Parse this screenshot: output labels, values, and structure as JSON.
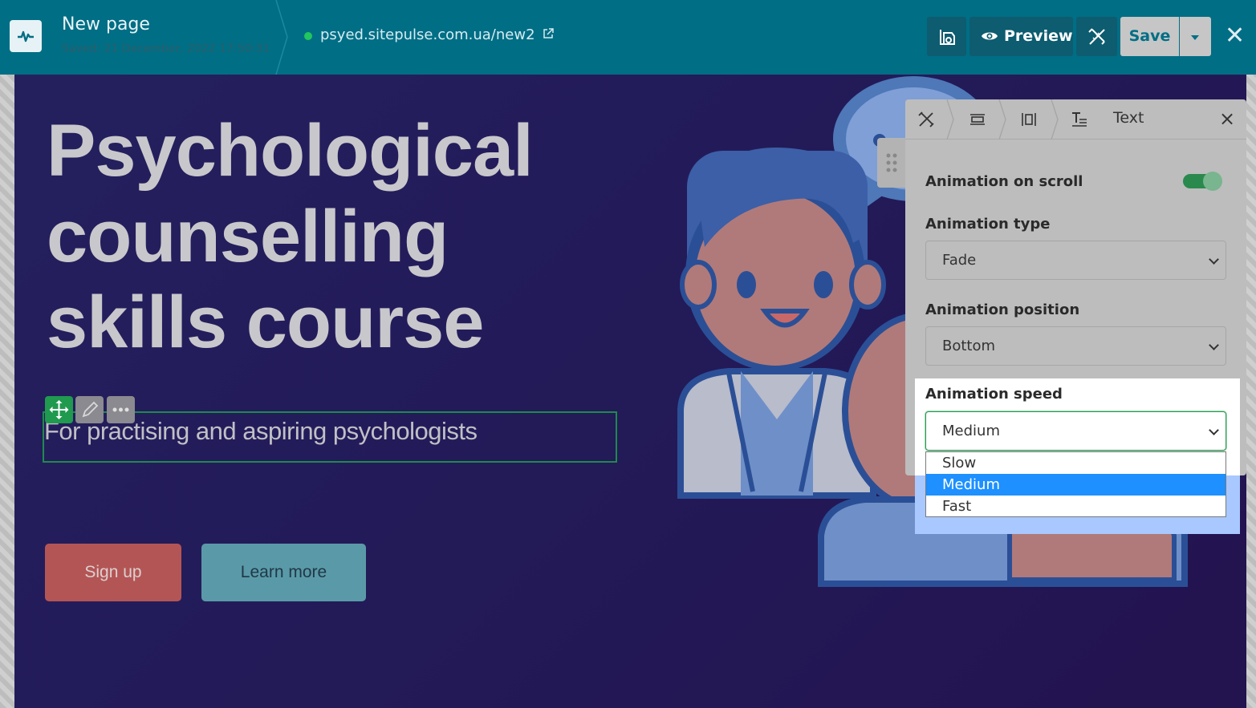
{
  "topbar": {
    "page_title": "New page",
    "saved_text": "Saved: 21 December, 2022 17:50:31",
    "url": "psyed.sitepulse.com.ua/new2",
    "preview_label": "Preview",
    "save_label": "Save",
    "close_symbol": "✕"
  },
  "hero": {
    "title": "Psychological counselling skills course",
    "subtitle": "For practising and aspiring psychologists",
    "signup_label": "Sign up",
    "learn_more_label": "Learn more"
  },
  "panel": {
    "tab_text": "Text",
    "close_symbol": "×",
    "animation_on_scroll_label": "Animation on scroll",
    "animation_on_scroll": true,
    "animation_type_label": "Animation type",
    "animation_type_value": "Fade",
    "animation_position_label": "Animation position",
    "animation_position_value": "Bottom",
    "animation_speed_label": "Animation speed",
    "animation_speed_value": "Medium",
    "speed_options": [
      "Slow",
      "Medium",
      "Fast"
    ],
    "speed_selected": "Medium"
  },
  "colors": {
    "topbar": "#006e85",
    "hero_bg": "#24205e",
    "signup": "#b45555",
    "learn_more": "#5a9aa8",
    "accent_green": "#2a8a4d",
    "highlight": "#1e90ff"
  },
  "icons": [
    "pulse-logo-icon",
    "external-link-icon",
    "theme-icon",
    "eye-icon",
    "design-tools-icon",
    "chevron-down-icon",
    "close-icon",
    "move-icon",
    "pencil-icon",
    "more-icon",
    "layout-icon",
    "spacing-icon",
    "text-format-icon",
    "drag-handle-icon"
  ]
}
